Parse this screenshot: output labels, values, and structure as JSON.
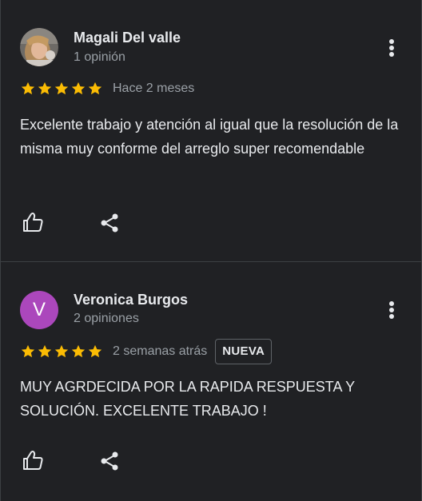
{
  "reviews": [
    {
      "author": "Magali Del valle",
      "review_count": "1 opinión",
      "avatar": "photo",
      "rating": 5,
      "date": "Hace 2 meses",
      "text": "Excelente trabajo y atención al igual que la resolución de la misma muy conforme del arreglo super recomendable"
    },
    {
      "author": "Veronica Burgos",
      "review_count": "2 opiniones",
      "avatar_letter": "V",
      "avatar_color": "#ab47bc",
      "rating": 5,
      "date": "2 semanas atrás",
      "badge": "NUEVA",
      "text": "MUY AGRDECIDA POR LA RAPIDA RESPUESTA Y SOLUCIÓN. EXCELENTE TRABAJO !"
    }
  ],
  "icons": {
    "more": "more-vert-icon",
    "like": "thumb-up-icon",
    "share": "share-icon",
    "star": "star-icon"
  },
  "colors": {
    "background": "#202124",
    "star": "#fbbc04",
    "text": "#e8eaed",
    "secondary_text": "#9aa0a6"
  }
}
